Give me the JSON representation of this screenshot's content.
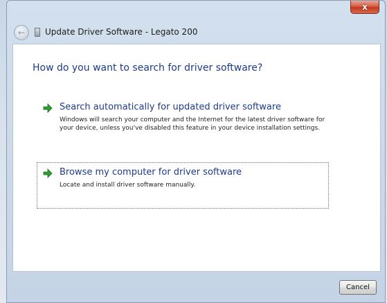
{
  "window": {
    "title": "Update Driver Software - Legato 200",
    "close_glyph": "x",
    "back_glyph": "←"
  },
  "main": {
    "heading": "How do you want to search for driver software?",
    "options": [
      {
        "title": "Search automatically for updated driver software",
        "description": "Windows will search your computer and the Internet for the latest driver software for your device, unless you've disabled this feature in your device installation settings.",
        "icon": "green-arrow-icon"
      },
      {
        "title": "Browse my computer for driver software",
        "description": "Locate and install driver software manually.",
        "icon": "green-arrow-icon"
      }
    ]
  },
  "footer": {
    "cancel_label": "Cancel"
  },
  "colors": {
    "link_blue": "#1e3a8a",
    "arrow_green": "#2e9e2e",
    "close_red": "#c4381d"
  }
}
